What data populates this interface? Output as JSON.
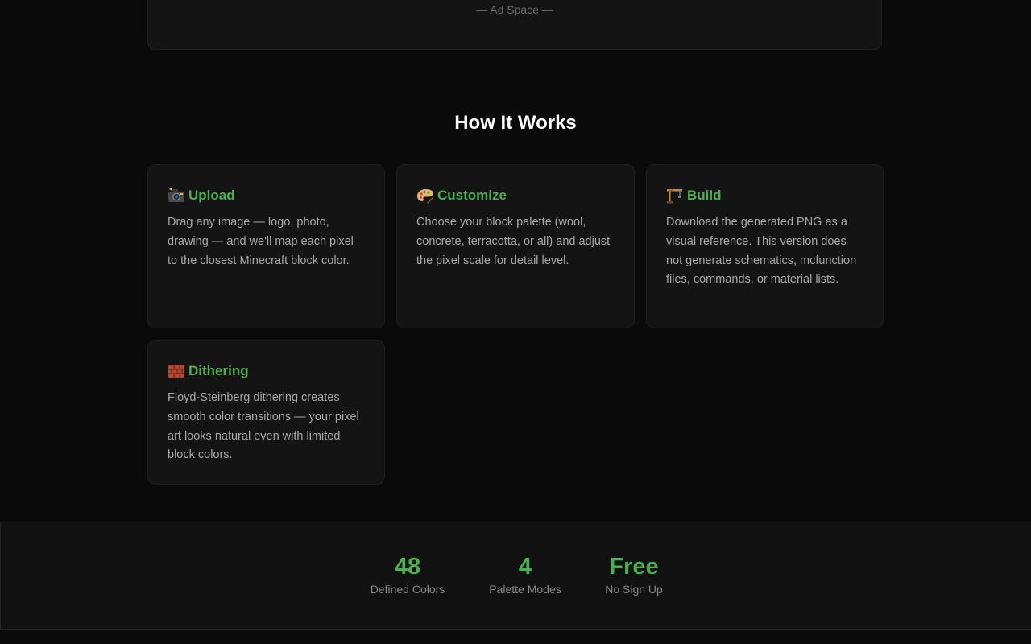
{
  "ad": {
    "label": "— Ad Space —"
  },
  "how_it_works": {
    "title": "How It Works",
    "cards": [
      {
        "icon": "camera-icon",
        "title": "Upload",
        "body": "Drag any image — logo, photo, drawing — and we'll map each pixel to the closest Minecraft block color."
      },
      {
        "icon": "palette-icon",
        "title": "Customize",
        "body": "Choose your block palette (wool, concrete, terracotta, or all) and adjust the pixel scale for detail level."
      },
      {
        "icon": "crane-icon",
        "title": "Build",
        "body": "Download the generated PNG as a visual reference. This version does not generate schematics, mcfunction files, commands, or material lists."
      },
      {
        "icon": "bricks-icon",
        "title": "Dithering",
        "body": "Floyd-Steinberg dithering creates smooth color transitions — your pixel art looks natural even with limited block colors."
      }
    ]
  },
  "stats": [
    {
      "value": "48",
      "label": "Defined Colors"
    },
    {
      "value": "4",
      "label": "Palette Modes"
    },
    {
      "value": "Free",
      "label": "No Sign Up"
    }
  ],
  "colors": {
    "accent": "#4caf50",
    "background": "#0a0a0a",
    "card": "#141414"
  }
}
